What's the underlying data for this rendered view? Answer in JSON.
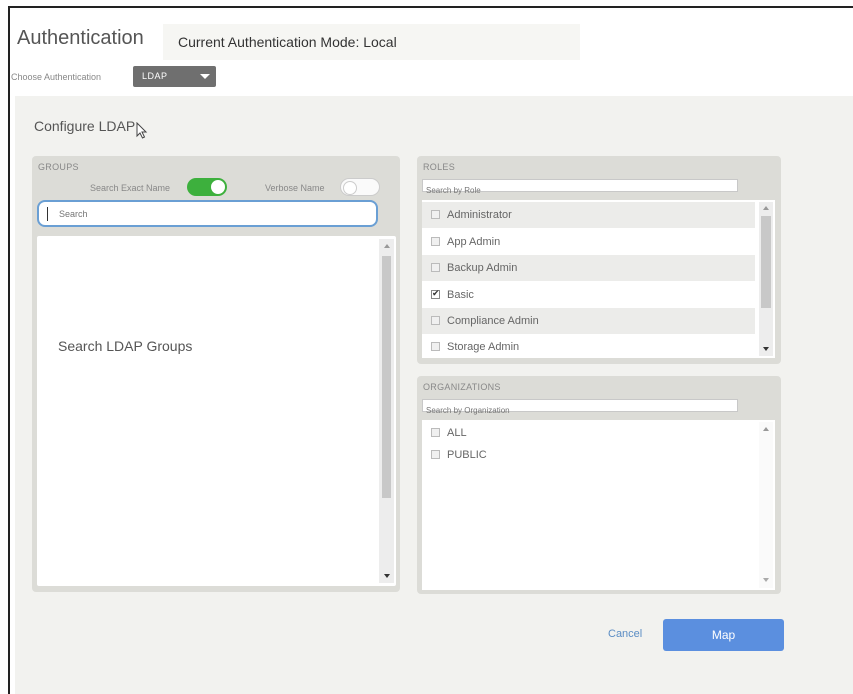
{
  "header": {
    "title": "Authentication",
    "current_mode": "Current Authentication Mode: Local"
  },
  "auth_choice": {
    "label": "Choose Authentication",
    "selected": "LDAP"
  },
  "configure": {
    "title": "Configure LDAP"
  },
  "groups": {
    "label": "GROUPS",
    "search_exact_label": "Search Exact Name",
    "search_exact_on": true,
    "verbose_label": "Verbose Name",
    "verbose_on": false,
    "search_placeholder": "Search",
    "empty_message": "Search LDAP Groups"
  },
  "roles": {
    "label": "ROLES",
    "search_placeholder": "Search by Role",
    "items": [
      {
        "label": "Administrator",
        "checked": false
      },
      {
        "label": "App Admin",
        "checked": false
      },
      {
        "label": "Backup Admin",
        "checked": false
      },
      {
        "label": "Basic",
        "checked": true
      },
      {
        "label": "Compliance Admin",
        "checked": false
      },
      {
        "label": "Storage Admin",
        "checked": false
      }
    ]
  },
  "organizations": {
    "label": "ORGANIZATIONS",
    "search_placeholder": "Search by Organization",
    "items": [
      {
        "label": "ALL",
        "checked": false
      },
      {
        "label": "PUBLIC",
        "checked": false
      }
    ]
  },
  "actions": {
    "cancel_label": "Cancel",
    "map_label": "Map"
  },
  "colors": {
    "toggle_on": "#3db03d",
    "primary_button": "#5b8fdf",
    "link": "#5b8dc4",
    "focus_border": "#6a9fd4"
  }
}
